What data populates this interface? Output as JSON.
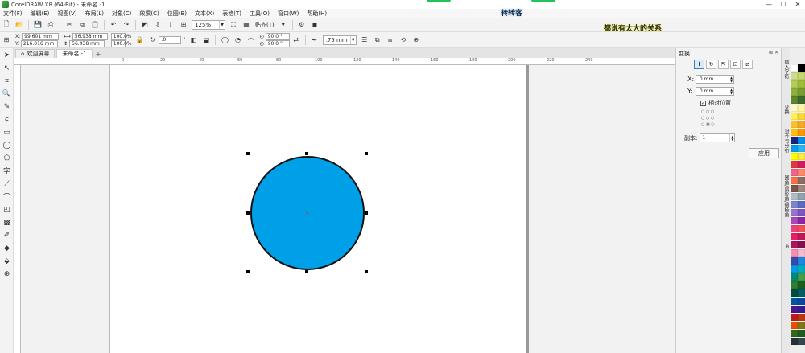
{
  "window": {
    "title": "CorelDRAW X8 (64-Bit) - 未命名 -1",
    "min": "—",
    "max": "☐",
    "close": "✕"
  },
  "watermarks": {
    "top": "转转客",
    "right": "都说有太大的关系"
  },
  "menu": [
    "文件(F)",
    "编辑(E)",
    "视图(V)",
    "布局(L)",
    "对象(C)",
    "效果(C)",
    "位图(B)",
    "文本(X)",
    "表格(T)",
    "工具(O)",
    "窗口(W)",
    "帮助(H)"
  ],
  "toolbar": {
    "zoom": "125%",
    "snap_label": "贴齐(T)"
  },
  "property_bar": {
    "x": "99.601 mm",
    "y": "216.016 mm",
    "w": "56.938 mm",
    "h": "56.938 mm",
    "scale_w": "100.0",
    "scale_h": "100.0",
    "pct": "%",
    "angle": ".0",
    "deg": "°",
    "start_angle": "90.0 °",
    "end_angle": "90.0 °",
    "outline": ".75 mm"
  },
  "tabs": {
    "welcome": "欢迎屏幕",
    "doc": "未命名 -1",
    "add": "+"
  },
  "ruler": {
    "h": [
      "0",
      "20",
      "40",
      "60",
      "80",
      "100",
      "120",
      "140",
      "160",
      "180",
      "200",
      "220",
      "240"
    ]
  },
  "docker": {
    "title": "变换",
    "x_label": "X:",
    "x_value": ".0 mm",
    "y_label": "Y:",
    "y_value": ".0 mm",
    "relative_label": "相对位置",
    "copies_label": "副本:",
    "copies_value": "1",
    "apply_label": "应用"
  },
  "side_tabs": [
    "插入字符",
    "变换",
    "对齐与分布",
    "圆角/扇形角/倒棱角"
  ],
  "palette": [
    "#ffffff",
    "#000000",
    "#cfdb8a",
    "#c7d76e",
    "#b6cc52",
    "#9fbe3a",
    "#8cb03a",
    "#7a9e33",
    "#5e8530",
    "#3b6b2c",
    "#fff8c2",
    "#fff59d",
    "#ffee58",
    "#fdd835",
    "#fbc02d",
    "#f9a825",
    "#ffc107",
    "#ff9800",
    "#1a237e",
    "#0091ea",
    "#00a0e9",
    "#29b6f6",
    "#ffff00",
    "#ffeb3b",
    "#e53935",
    "#d81b60",
    "#f06292",
    "#ff8a65",
    "#ff7043",
    "#8d6e63",
    "#795548",
    "#a1887f",
    "#b0bec5",
    "#90a4ae",
    "#7986cb",
    "#5c6bc0",
    "#9575cd",
    "#7e57c2",
    "#ab47bc",
    "#8e24aa",
    "#ec407a",
    "#ef5350",
    "#e91e63",
    "#c2185b",
    "#ad1457",
    "#880e4f",
    "#f48fb1",
    "#f8bbd0",
    "#3949ab",
    "#1e88e5",
    "#039be5",
    "#00acc1",
    "#00897b",
    "#43a047",
    "#2e7d32",
    "#1b5e20",
    "#004d40",
    "#006064",
    "#01579b",
    "#0d47a1",
    "#4a148c",
    "#311b92",
    "#b71c1c",
    "#bf360c",
    "#e65100",
    "#827717",
    "#33691e",
    "#1b5e20",
    "#263238",
    "#37474f"
  ]
}
